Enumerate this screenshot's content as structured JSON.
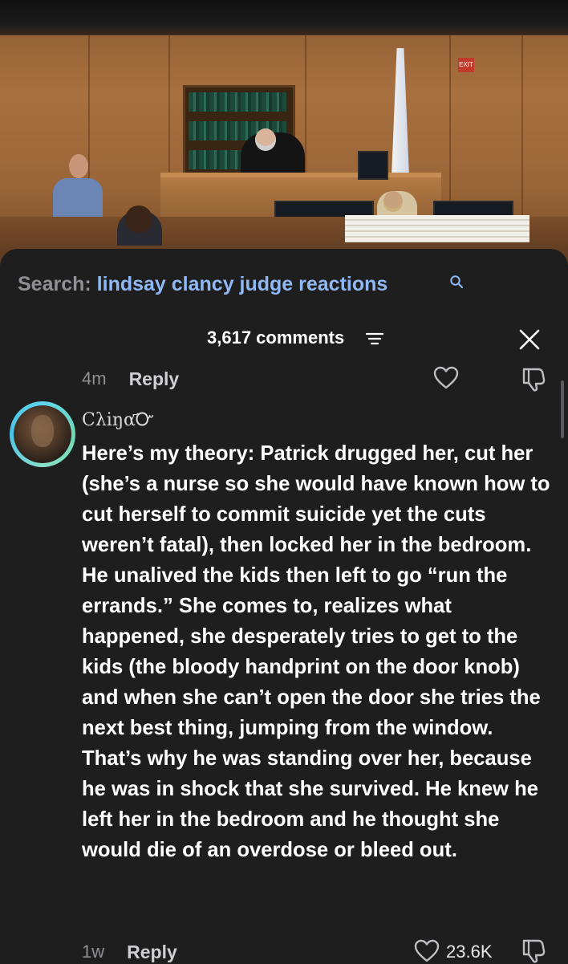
{
  "search": {
    "label": "Search:",
    "query": "lindsay clancy judge reactions",
    "icon": "search-icon"
  },
  "video": {
    "exit_sign": "EXIT"
  },
  "comments_header": {
    "count": "3,617 comments",
    "sort_icon": "sort-icon",
    "close_icon": "close-icon"
  },
  "previous_comment": {
    "time": "4m",
    "reply_label": "Reply"
  },
  "comment": {
    "username": "Cλiŋα҃Ꮕ",
    "text": "Here’s my theory: Patrick drugged her, cut her (she’s a nurse so she would have known how to cut herself to commit suicide yet the cuts weren’t fatal), then locked her in the bedroom. He unalived the kids then left to go “run the errands.” She comes to, realizes what happened, she desperately tries to get to the kids (the bloody handprint on the door knob) and when she can’t open the door she tries the next best thing, jumping from the window. That’s why he was standing over her, because he was in shock that she survived. He knew he left her in the bedroom and he thought she would die of an overdose or bleed out.",
    "time": "1w",
    "reply_label": "Reply",
    "likes": "23.6K"
  },
  "colors": {
    "background": "#1e1e1e",
    "search_query": "#8fb8f5",
    "muted": "#8f8f94",
    "avatar_ring": "#5dd6f0"
  }
}
